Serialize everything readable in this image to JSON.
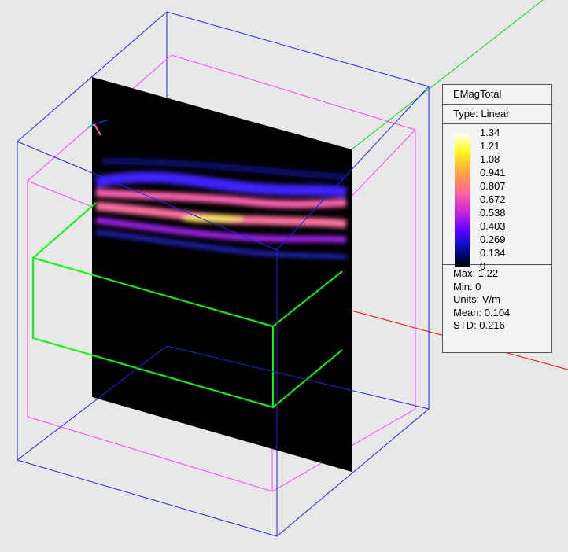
{
  "legend": {
    "title": "EMagTotal",
    "type": "Type: Linear",
    "ticks": [
      "1.34",
      "1.21",
      "1.08",
      "0.941",
      "0.807",
      "0.672",
      "0.538",
      "0.403",
      "0.269",
      "0.134",
      "0"
    ],
    "stats": {
      "max": "Max: 1.22",
      "min": "Min: 0",
      "units": "Units: V/m",
      "mean": "Mean: 0.104",
      "std": "STD: 0.216"
    }
  },
  "colors": {
    "outer_box": "#2020ff",
    "inner_box": "#ff40ff",
    "object_box": "#00ff00",
    "axis_x": "#ff0000",
    "axis_y": "#00e000",
    "plane": "#000000"
  }
}
